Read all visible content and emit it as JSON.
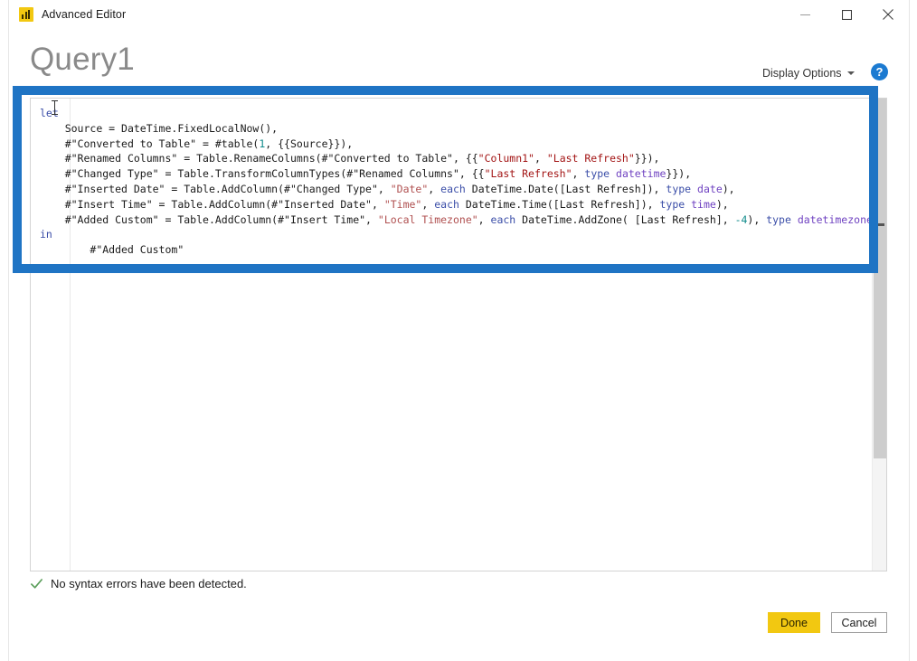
{
  "window": {
    "title": "Advanced Editor",
    "app_icon": "power-bi-bar-chart-icon",
    "controls": {
      "minimize": "minimize-icon",
      "maximize": "maximize-icon",
      "close": "close-icon"
    }
  },
  "header": {
    "query_title": "Query1",
    "display_options_label": "Display Options",
    "display_options_caret": "chevron-down-icon",
    "help_label": "?"
  },
  "editor": {
    "language": "Power Query M",
    "code_lines": [
      {
        "indent": 0,
        "tokens": [
          {
            "text": "let",
            "style": "kw"
          }
        ]
      },
      {
        "indent": 1,
        "tokens": [
          {
            "text": "Source = DateTime.FixedLocalNow(),",
            "style": "plain"
          }
        ]
      },
      {
        "indent": 1,
        "tokens": [
          {
            "text": "#\"Converted to Table\" = #table(",
            "style": "plain"
          },
          {
            "text": "1",
            "style": "num"
          },
          {
            "text": ", {{Source}}),",
            "style": "plain"
          }
        ]
      },
      {
        "indent": 1,
        "tokens": [
          {
            "text": "#\"Renamed Columns\" = Table.RenameColumns(#\"Converted to Table\", {{",
            "style": "plain"
          },
          {
            "text": "\"Column1\"",
            "style": "str"
          },
          {
            "text": ", ",
            "style": "plain"
          },
          {
            "text": "\"Last Refresh\"",
            "style": "str"
          },
          {
            "text": "}}),",
            "style": "plain"
          }
        ]
      },
      {
        "indent": 1,
        "tokens": [
          {
            "text": "#\"Changed Type\" = Table.TransformColumnTypes(#\"Renamed Columns\", {{",
            "style": "plain"
          },
          {
            "text": "\"Last Refresh\"",
            "style": "str"
          },
          {
            "text": ", ",
            "style": "plain"
          },
          {
            "text": "type",
            "style": "kw"
          },
          {
            "text": " ",
            "style": "plain"
          },
          {
            "text": "datetime",
            "style": "type"
          },
          {
            "text": "}}),",
            "style": "plain"
          }
        ]
      },
      {
        "indent": 1,
        "tokens": [
          {
            "text": "#\"Inserted Date\" = Table.AddColumn(#\"Changed Type\", ",
            "style": "plain"
          },
          {
            "text": "\"Date\"",
            "style": "str2"
          },
          {
            "text": ", ",
            "style": "plain"
          },
          {
            "text": "each",
            "style": "kw"
          },
          {
            "text": " DateTime.Date([Last Refresh]), ",
            "style": "plain"
          },
          {
            "text": "type",
            "style": "kw"
          },
          {
            "text": " ",
            "style": "plain"
          },
          {
            "text": "date",
            "style": "type"
          },
          {
            "text": "),",
            "style": "plain"
          }
        ]
      },
      {
        "indent": 1,
        "tokens": [
          {
            "text": "#\"Insert Time\" = Table.AddColumn(#\"Inserted Date\", ",
            "style": "plain"
          },
          {
            "text": "\"Time\"",
            "style": "str2"
          },
          {
            "text": ", ",
            "style": "plain"
          },
          {
            "text": "each",
            "style": "kw"
          },
          {
            "text": " DateTime.Time([Last Refresh]), ",
            "style": "plain"
          },
          {
            "text": "type",
            "style": "kw"
          },
          {
            "text": " ",
            "style": "plain"
          },
          {
            "text": "time",
            "style": "type"
          },
          {
            "text": "),",
            "style": "plain"
          }
        ]
      },
      {
        "indent": 1,
        "tokens": [
          {
            "text": "#\"Added Custom\" = Table.AddColumn(#\"Insert Time\", ",
            "style": "plain"
          },
          {
            "text": "\"Local Timezone\"",
            "style": "str2"
          },
          {
            "text": ", ",
            "style": "plain"
          },
          {
            "text": "each",
            "style": "kw"
          },
          {
            "text": " DateTime.AddZone( [Last Refresh], ",
            "style": "plain"
          },
          {
            "text": "-4",
            "style": "num"
          },
          {
            "text": "), ",
            "style": "plain"
          },
          {
            "text": "type",
            "style": "kw"
          },
          {
            "text": " ",
            "style": "plain"
          },
          {
            "text": "datetimezone",
            "style": "type"
          },
          {
            "text": " )",
            "style": "plain"
          }
        ]
      },
      {
        "indent": 0,
        "tokens": [
          {
            "text": "in",
            "style": "kw"
          }
        ]
      },
      {
        "indent": 2,
        "tokens": [
          {
            "text": "#\"Added Custom\"",
            "style": "plain"
          }
        ]
      }
    ],
    "scrollbar": {
      "orientation": "vertical",
      "thumb_position_percent": 0
    }
  },
  "annotation": {
    "type": "rectangle-highlight",
    "color": "#1f74c4"
  },
  "status": {
    "icon": "checkmark-icon",
    "text": "No syntax errors have been detected.",
    "color": "#5a9e5a"
  },
  "footer": {
    "done_label": "Done",
    "cancel_label": "Cancel",
    "done_color": "#f2c811"
  }
}
